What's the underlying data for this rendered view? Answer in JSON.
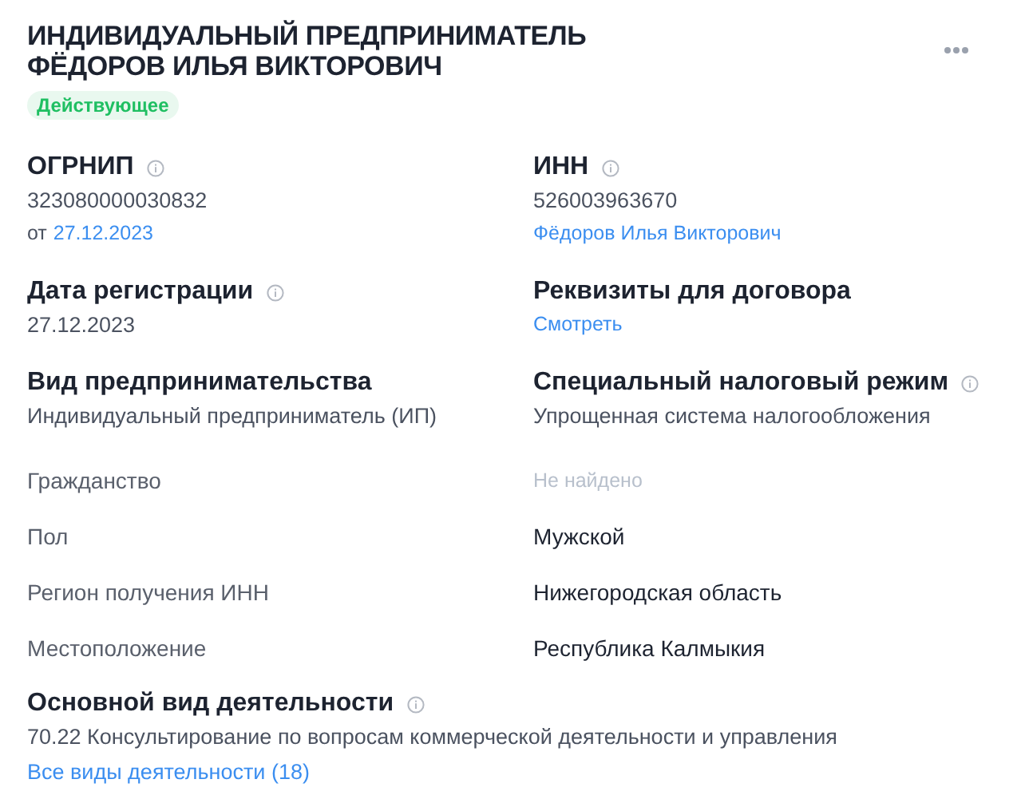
{
  "header": {
    "title_lines": [
      "ИНДИВИДУАЛЬНЫЙ ПРЕДПРИНИМАТЕЛЬ",
      "ФЁДОРОВ ИЛЬЯ ВИКТОРОВИЧ"
    ],
    "status": "Действующее"
  },
  "sections": [
    {
      "title": "ОГРНИП",
      "info": true,
      "lines": [
        {
          "kind": "value",
          "text": "323080000030832"
        },
        {
          "kind": "dated",
          "prefix": "от",
          "link": "27.12.2023"
        }
      ]
    },
    {
      "title": "ИНН",
      "info": true,
      "lines": [
        {
          "kind": "value",
          "text": "526003963670"
        },
        {
          "kind": "link",
          "text": "Фёдоров Илья Викторович"
        }
      ]
    },
    {
      "title": "Дата регистрации",
      "info": true,
      "lines": [
        {
          "kind": "value",
          "text": "27.12.2023"
        }
      ]
    },
    {
      "title": "Реквизиты для договора",
      "info": false,
      "lines": [
        {
          "kind": "link",
          "text": "Смотреть"
        }
      ]
    },
    {
      "title": "Вид предпринимательства",
      "info": false,
      "lines": [
        {
          "kind": "value",
          "text": "Индивидуальный предприниматель (ИП)"
        }
      ]
    },
    {
      "title": "Специальный налоговый режим",
      "info": true,
      "lines": [
        {
          "kind": "value",
          "text": "Упрощенная система налогообложения"
        }
      ]
    }
  ],
  "details": [
    {
      "label": "Гражданство",
      "value": "Не найдено",
      "found": false
    },
    {
      "label": "Пол",
      "value": "Мужской",
      "found": true
    },
    {
      "label": "Регион получения ИНН",
      "value": "Нижегородская область",
      "found": true
    },
    {
      "label": "Местоположение",
      "value": "Республика Калмыкия",
      "found": true
    }
  ],
  "activity": {
    "title": "Основной вид деятельности",
    "info": true,
    "text": "70.22 Консультирование по вопросам коммерческой деятельности и управления",
    "link": "Все виды деятельности (18)"
  }
}
